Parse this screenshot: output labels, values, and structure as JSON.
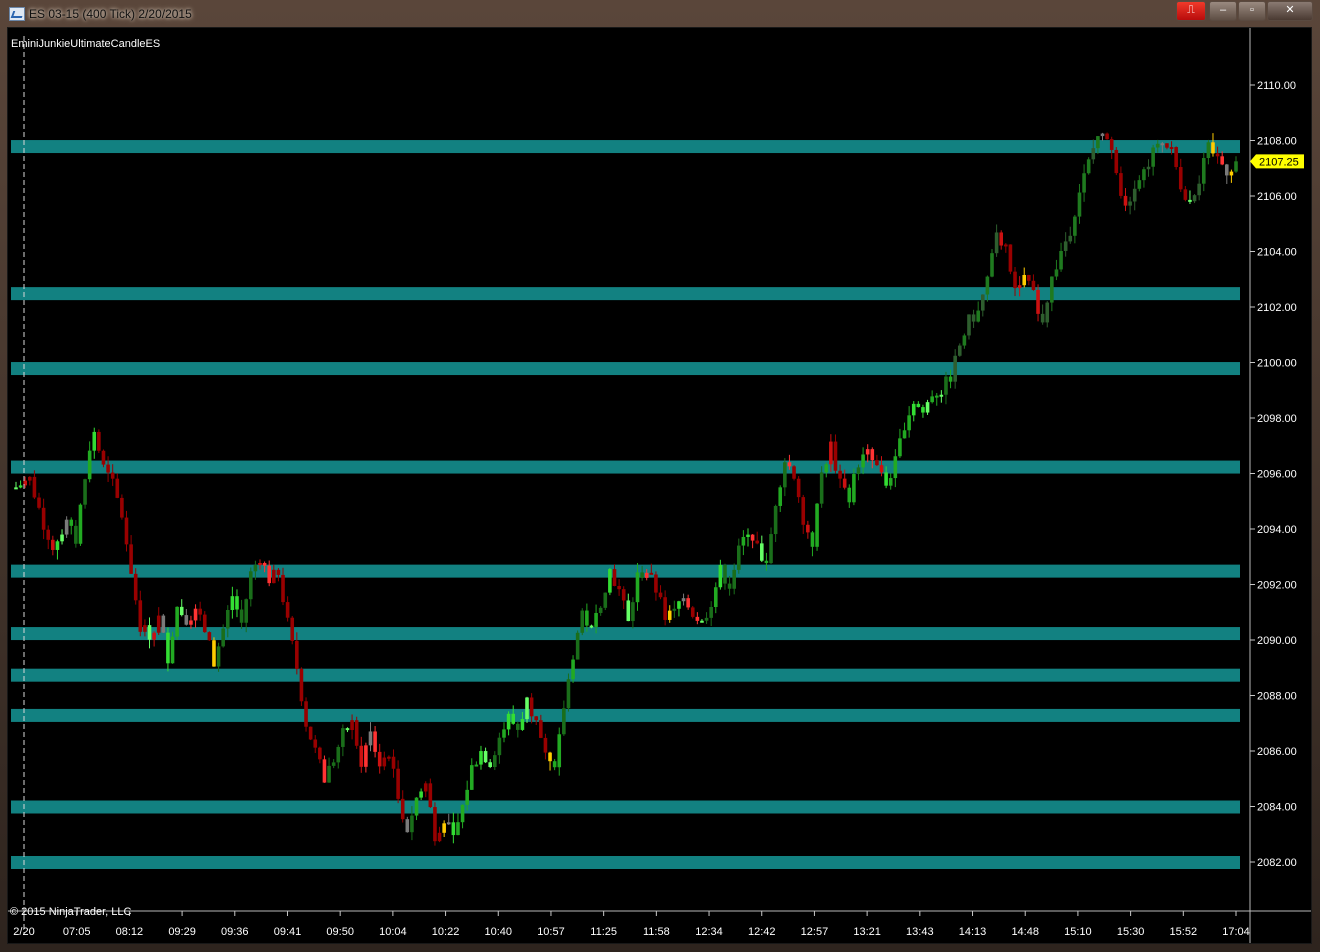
{
  "window": {
    "title": "ES 03-15 (400 Tick)  2/20/2015",
    "min_glyph": "–",
    "max_glyph": "▫",
    "close_glyph": "✕",
    "red_button_glyph": "⎍"
  },
  "chart_data": {
    "type": "candlestick",
    "instrument": "ES 03-15 (400 Tick)",
    "indicator_label": "EminiJunkieUltimateCandleES",
    "copyright": "© 2015 NinjaTrader, LLC",
    "last_price": 2107.25,
    "last_price_label": "2107.25",
    "y_range": [
      2080.0,
      2111.5
    ],
    "y_ticks": [
      2082,
      2084,
      2086,
      2088,
      2090,
      2092,
      2094,
      2096,
      2098,
      2100,
      2102,
      2104,
      2106,
      2108,
      2110
    ],
    "y_tick_labels": [
      "2082.00",
      "2084.00",
      "2086.00",
      "2088.00",
      "2090.00",
      "2092.00",
      "2094.00",
      "2096.00",
      "2098.00",
      "2100.00",
      "2102.00",
      "2104.00",
      "2106.00",
      "2108.00",
      "2110.00"
    ],
    "x_tick_labels": [
      "2/20",
      "07:05",
      "08:12",
      "09:29",
      "09:36",
      "09:41",
      "09:50",
      "10:04",
      "10:22",
      "10:40",
      "10:57",
      "11:25",
      "11:58",
      "12:34",
      "12:42",
      "12:57",
      "13:21",
      "13:43",
      "14:13",
      "14:48",
      "15:10",
      "15:30",
      "15:52",
      "17:04"
    ],
    "horizontal_levels": [
      2082.0,
      2084.0,
      2087.3,
      2088.75,
      2090.25,
      2092.5,
      2096.25,
      2099.8,
      2102.5,
      2107.8
    ],
    "price_path": [
      [
        0,
        2095.5
      ],
      [
        3,
        2095.8
      ],
      [
        6,
        2094.2
      ],
      [
        8,
        2093.4
      ],
      [
        11,
        2094.2
      ],
      [
        13,
        2093.6
      ],
      [
        15,
        2096
      ],
      [
        17,
        2097.5
      ],
      [
        19,
        2096.2
      ],
      [
        21,
        2095.6
      ],
      [
        23,
        2094.5
      ],
      [
        25,
        2092.5
      ],
      [
        27,
        2090.5
      ],
      [
        29,
        2090.2
      ],
      [
        31,
        2090.8
      ],
      [
        33,
        2089.4
      ],
      [
        35,
        2091.2
      ],
      [
        37,
        2090.8
      ],
      [
        39,
        2091
      ],
      [
        41,
        2090.4
      ],
      [
        43,
        2089.2
      ],
      [
        45,
        2090.4
      ],
      [
        47,
        2091.6
      ],
      [
        49,
        2090.6
      ],
      [
        51,
        2092.4
      ],
      [
        53,
        2093
      ],
      [
        55,
        2092.2
      ],
      [
        57,
        2092.4
      ],
      [
        59,
        2090.6
      ],
      [
        61,
        2089
      ],
      [
        63,
        2087
      ],
      [
        65,
        2086
      ],
      [
        67,
        2085
      ],
      [
        69,
        2085.7
      ],
      [
        71,
        2086.6
      ],
      [
        73,
        2087
      ],
      [
        75,
        2085.6
      ],
      [
        77,
        2086.6
      ],
      [
        79,
        2085.5
      ],
      [
        81,
        2086
      ],
      [
        83,
        2084.3
      ],
      [
        85,
        2083.2
      ],
      [
        87,
        2084.3
      ],
      [
        89,
        2084.8
      ],
      [
        91,
        2083
      ],
      [
        93,
        2083.6
      ],
      [
        95,
        2082.8
      ],
      [
        97,
        2084
      ],
      [
        99,
        2085.4
      ],
      [
        101,
        2086
      ],
      [
        103,
        2085.6
      ],
      [
        105,
        2086.5
      ],
      [
        107,
        2087.2
      ],
      [
        109,
        2086.8
      ],
      [
        111,
        2087.8
      ],
      [
        113,
        2087.2
      ],
      [
        115,
        2085.8
      ],
      [
        117,
        2085.2
      ],
      [
        119,
        2087.6
      ],
      [
        121,
        2089.5
      ],
      [
        123,
        2091
      ],
      [
        125,
        2090.3
      ],
      [
        127,
        2091.4
      ],
      [
        129,
        2092.5
      ],
      [
        131,
        2091.8
      ],
      [
        133,
        2090.6
      ],
      [
        135,
        2092.3
      ],
      [
        137,
        2092.5
      ],
      [
        139,
        2091.8
      ],
      [
        141,
        2090.8
      ],
      [
        143,
        2091
      ],
      [
        145,
        2091.7
      ],
      [
        147,
        2091
      ],
      [
        149,
        2090.6
      ],
      [
        151,
        2091.4
      ],
      [
        153,
        2092.5
      ],
      [
        155,
        2092
      ],
      [
        157,
        2093.2
      ],
      [
        159,
        2094
      ],
      [
        161,
        2093.4
      ],
      [
        163,
        2092.6
      ],
      [
        165,
        2095
      ],
      [
        167,
        2096.5
      ],
      [
        169,
        2096
      ],
      [
        171,
        2094.4
      ],
      [
        173,
        2093.5
      ],
      [
        175,
        2096
      ],
      [
        177,
        2097
      ],
      [
        179,
        2095.6
      ],
      [
        181,
        2095.2
      ],
      [
        183,
        2096.4
      ],
      [
        185,
        2096.7
      ],
      [
        187,
        2096.2
      ],
      [
        189,
        2095.6
      ],
      [
        191,
        2096.4
      ],
      [
        193,
        2097.8
      ],
      [
        195,
        2098.6
      ],
      [
        197,
        2098.2
      ],
      [
        199,
        2098.9
      ],
      [
        201,
        2099
      ],
      [
        203,
        2099.5
      ],
      [
        205,
        2100.6
      ],
      [
        207,
        2101.5
      ],
      [
        209,
        2101.8
      ],
      [
        211,
        2103
      ],
      [
        213,
        2104.5
      ],
      [
        215,
        2104.2
      ],
      [
        217,
        2102.5
      ],
      [
        219,
        2103
      ],
      [
        221,
        2102.4
      ],
      [
        223,
        2101.6
      ],
      [
        225,
        2103
      ],
      [
        227,
        2104
      ],
      [
        229,
        2104.8
      ],
      [
        231,
        2106.2
      ],
      [
        233,
        2107.2
      ],
      [
        235,
        2108.2
      ],
      [
        237,
        2108
      ],
      [
        239,
        2107
      ],
      [
        241,
        2105.5
      ],
      [
        243,
        2106.5
      ],
      [
        245,
        2106.9
      ],
      [
        247,
        2107.6
      ],
      [
        249,
        2107.9
      ],
      [
        251,
        2107.6
      ],
      [
        253,
        2106.4
      ],
      [
        255,
        2105.8
      ],
      [
        257,
        2106.6
      ],
      [
        259,
        2107.7
      ],
      [
        261,
        2107.4
      ],
      [
        263,
        2106.9
      ],
      [
        265,
        2107.25
      ]
    ]
  }
}
